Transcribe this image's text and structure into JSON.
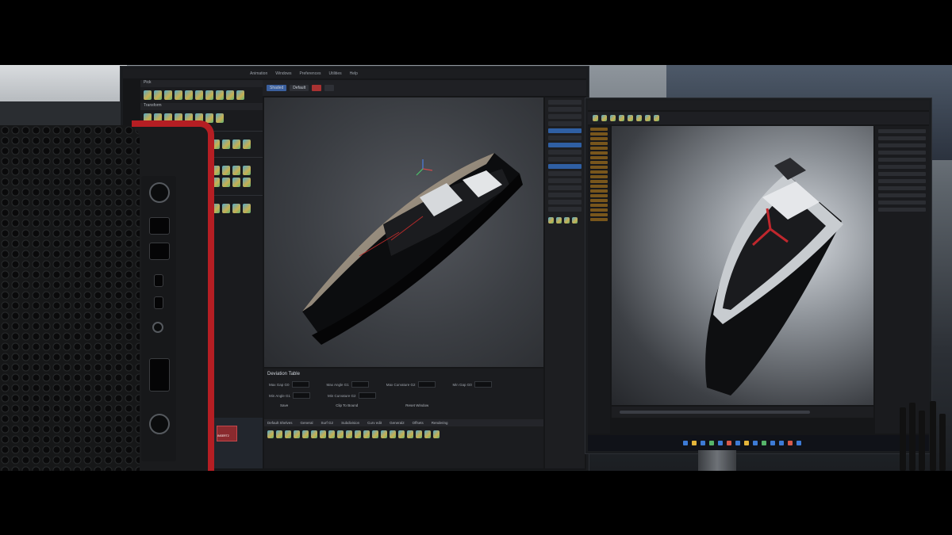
{
  "scene": {
    "description_free": true
  },
  "left_monitor": {
    "menu_items": [
      "Animation",
      "Windows",
      "Preferences",
      "Utilities",
      "Help"
    ],
    "toolbar_buttons": [
      "Shaded",
      "Default"
    ],
    "panel_headers": [
      "Pick",
      "Transform"
    ],
    "bottom_panel": {
      "title": "Deviation Table",
      "fields": [
        "Max Gap G0",
        "Min Gap G0",
        "Max Angle G1",
        "Min Angle G1",
        "Max Curvature G2",
        "Min Curvature G2"
      ],
      "buttons": [
        "Save",
        "Clip To Bound",
        "Reset Window"
      ],
      "shelf_title": "Default Shelves",
      "shelf_tabs": [
        "General",
        "Surf G2",
        "Subdivision",
        "Curv edit",
        "General2",
        "Bhood/Crv_Tools",
        "Curves (G0)",
        "Surfaces (G2)",
        "Surfaces (G2)",
        "Offsets",
        "Offset (Sublvl)",
        "Rendering",
        "Analysis",
        "Display",
        "Object",
        "Fix"
      ]
    },
    "thumbnails": [
      "INSERT2",
      "INSERT2",
      "INSERT2"
    ]
  },
  "right_monitor": {
    "timeline_label": "",
    "taskbar_icon_count": 14
  },
  "colors": {
    "tower_red": "#b51e23",
    "selection_blue": "#2f5fa3",
    "outliner_orange": "#c98b1e"
  }
}
